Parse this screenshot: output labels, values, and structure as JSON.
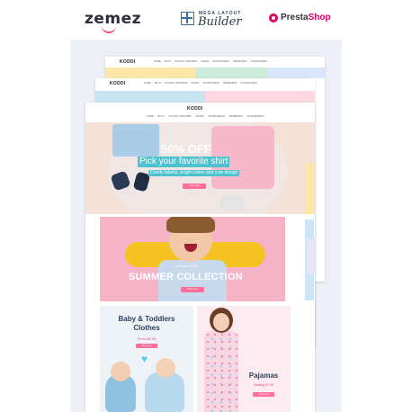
{
  "logos": {
    "zemez": "zemez",
    "mlb_top": "MEGA LAYOUT",
    "mlb_main": "Builder",
    "prestashop_a": "Presta",
    "prestashop_b": "Shop"
  },
  "brand": "KODDI",
  "nav": [
    "HOME",
    "BOYS",
    "SCHOOL UNIFORMS",
    "SHOES",
    "SPORTSWEAR",
    "NEWBORNS",
    "ACCESSORIES"
  ],
  "hero": {
    "headline": "50% OFF",
    "subheadline": "Pick your favorite shirt",
    "tagline": "Comfy fabrics, bright colors and cute design",
    "button": "Shop now"
  },
  "summer": {
    "pretitle": "Limited Prices",
    "title": "SUMMER COLLECTION",
    "button": "Shop now"
  },
  "baby": {
    "title_line1": "Baby & Toddlers",
    "title_line2": "Clothes",
    "from": "From $4.99",
    "button": "Shop now",
    "heart_icon": "♥"
  },
  "pajamas": {
    "title": "Pajamas",
    "from": "Starting $7.99",
    "button": "Shop now"
  },
  "colors": {
    "accent_pink": "#ff6d98",
    "accent_teal": "#4fc2cf",
    "prestashop": "#df0067"
  }
}
